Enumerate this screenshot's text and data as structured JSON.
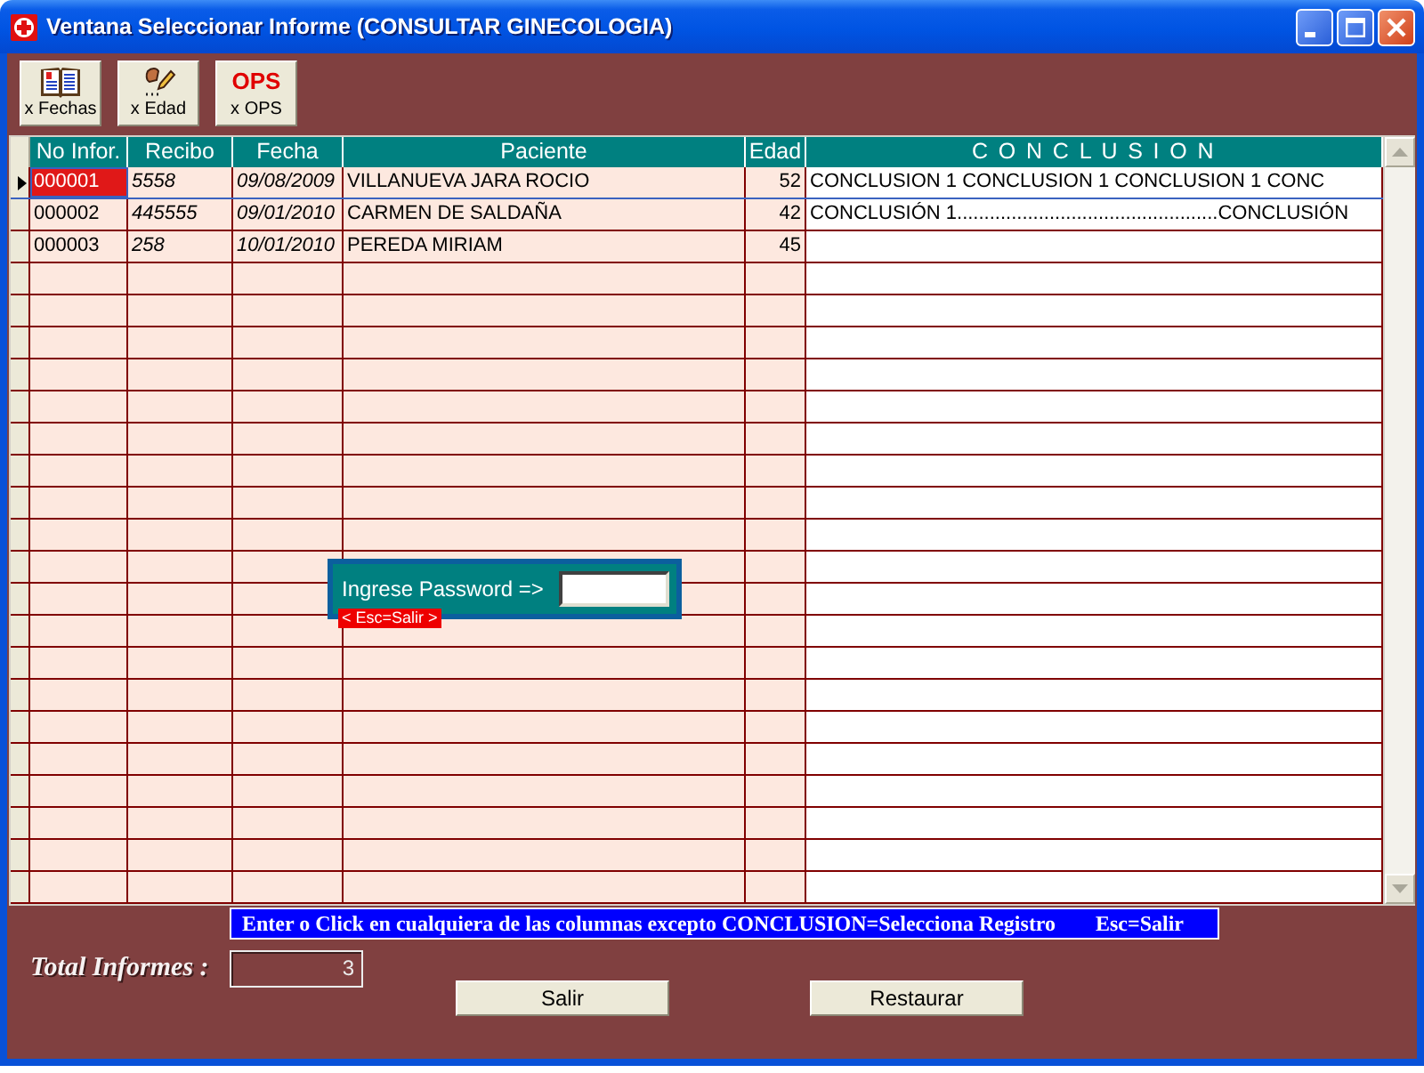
{
  "window": {
    "title": "Ventana Seleccionar Informe (CONSULTAR GINECOLOGIA)"
  },
  "toolbar": [
    {
      "kind": "book",
      "label": "x Fechas"
    },
    {
      "kind": "pen",
      "label": "x Edad"
    },
    {
      "kind": "text",
      "icon_text": "OPS",
      "label": "x OPS"
    }
  ],
  "table": {
    "columns": [
      "No Infor.",
      "Recibo",
      "Fecha",
      "Paciente",
      "Edad",
      "C O N C L U S I O N"
    ],
    "rows": [
      {
        "selected": true,
        "cells": [
          "000001",
          "5558",
          "09/08/2009",
          "VILLANUEVA JARA ROCIO",
          "52",
          "CONCLUSION 1 CONCLUSION 1 CONCLUSION 1 CONC"
        ]
      },
      {
        "selected": false,
        "cells": [
          "000002",
          "445555",
          "09/01/2010",
          "CARMEN DE SALDAÑA",
          "42",
          "CONCLUSIÓN 1................................................CONCLUSIÓN"
        ]
      },
      {
        "selected": false,
        "cells": [
          "000003",
          "258",
          "10/01/2010",
          "PEREDA MIRIAM",
          "45"
        ]
      }
    ]
  },
  "password_prompt": {
    "label": "Ingrese Password =>",
    "hint": "< Esc=Salir >"
  },
  "hint_bar": {
    "text": "Enter o Click en cualquiera de las columnas excepto CONCLUSION=Selecciona Registro",
    "shortcut": "Esc=Salir"
  },
  "total": {
    "label": "Total Informes :",
    "value": "3"
  },
  "buttons": [
    "Salir",
    "Restaurar"
  ]
}
